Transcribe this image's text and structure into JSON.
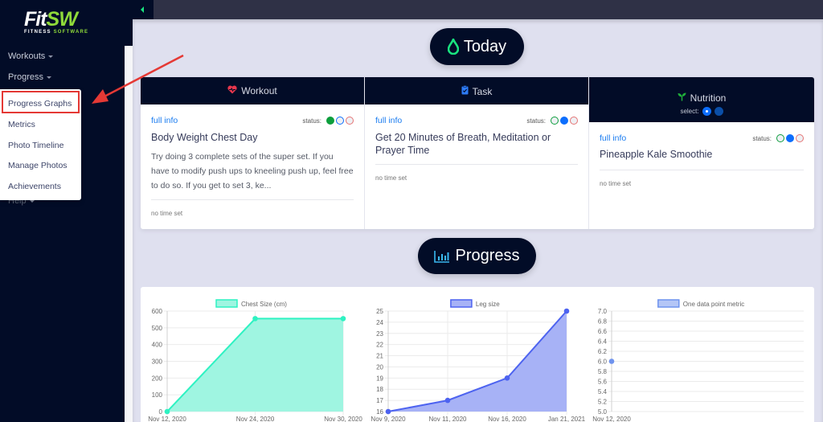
{
  "app": {
    "logo_main": "Fit",
    "logo_accent": "SW",
    "logo_sub_main": "FITNESS ",
    "logo_sub_accent": "SOFTWARE"
  },
  "sidebar": {
    "items": [
      {
        "label": "Workouts",
        "has_caret": true
      },
      {
        "label": "Progress",
        "has_caret": true
      },
      {
        "label": "Help",
        "has_caret": true
      }
    ],
    "dropdown": {
      "items": [
        {
          "label": "Progress Graphs",
          "highlighted": true
        },
        {
          "label": "Metrics"
        },
        {
          "label": "Photo Timeline"
        },
        {
          "label": "Manage Photos"
        },
        {
          "label": "Achievements"
        }
      ]
    }
  },
  "today": {
    "title": "Today",
    "icon": "drop-icon",
    "cards": [
      {
        "header": "Workout",
        "icon": "heartbeat-icon",
        "full_info": "full info",
        "status_label": "status:",
        "status_selected": "complete",
        "title": "Body Weight Chest Day",
        "description": "Try doing 3 complete sets of the super set. If you have to modify push ups to kneeling push up, feel free to do so. If you get to set 3, ke...",
        "time": "no time set"
      },
      {
        "header": "Task",
        "icon": "clipboard-check-icon",
        "full_info": "full info",
        "status_label": "status:",
        "status_selected": "pending",
        "title": "Get 20 Minutes of Breath, Meditation or Prayer Time",
        "time": "no time set"
      },
      {
        "header": "Nutrition",
        "icon": "seedling-icon",
        "select_label": "select:",
        "select_options": 2,
        "select_active": 1,
        "full_info": "full info",
        "status_label": "status:",
        "status_selected": "pending",
        "title": "Pineapple Kale Smoothie",
        "time": "no time set"
      }
    ]
  },
  "progress": {
    "title": "Progress",
    "icon": "bar-chart-icon"
  },
  "colors": {
    "navy": "#020c27",
    "accent_green": "#19e37f",
    "link_blue": "#1a7cf0",
    "status_green": "#0c9e3c",
    "status_blue": "#0d6efd",
    "status_red": "#e57373",
    "chest_line": "#2ef2c2",
    "chest_fill": "#9ff5e1",
    "leg_line": "#4d63f0",
    "leg_fill": "#a7b2f6",
    "metric_line": "#6f93ee",
    "annotation_red": "#e53935"
  },
  "chart_data": [
    {
      "type": "area",
      "title": "",
      "legend": "Chest Size (cm)",
      "legend_position": "top",
      "x": [
        "Nov 12, 2020",
        "Nov 24, 2020",
        "Nov 30, 2020"
      ],
      "values": [
        0,
        555,
        555
      ],
      "ylim": [
        0,
        600
      ],
      "yticks": [
        0,
        100,
        200,
        300,
        400,
        500,
        600
      ],
      "grid": true
    },
    {
      "type": "area",
      "title": "",
      "legend": "Leg size",
      "legend_position": "top",
      "x": [
        "Nov 9, 2020",
        "Nov 11, 2020",
        "Nov 16, 2020",
        "Jan 21, 2021"
      ],
      "values": [
        16,
        17,
        19,
        25
      ],
      "ylim": [
        16,
        25
      ],
      "yticks": [
        16,
        17,
        18,
        19,
        20,
        21,
        22,
        23,
        24,
        25
      ],
      "grid": true
    },
    {
      "type": "line",
      "title": "",
      "legend": "One data point metric",
      "legend_position": "top",
      "x": [
        "Nov 12, 2020"
      ],
      "values": [
        6.0
      ],
      "ylim": [
        5.0,
        7.0
      ],
      "yticks": [
        "5.0",
        "5.2",
        "5.4",
        "5.6",
        "5.8",
        "6.0",
        "6.2",
        "6.4",
        "6.6",
        "6.8",
        "7.0"
      ],
      "grid": true
    }
  ]
}
